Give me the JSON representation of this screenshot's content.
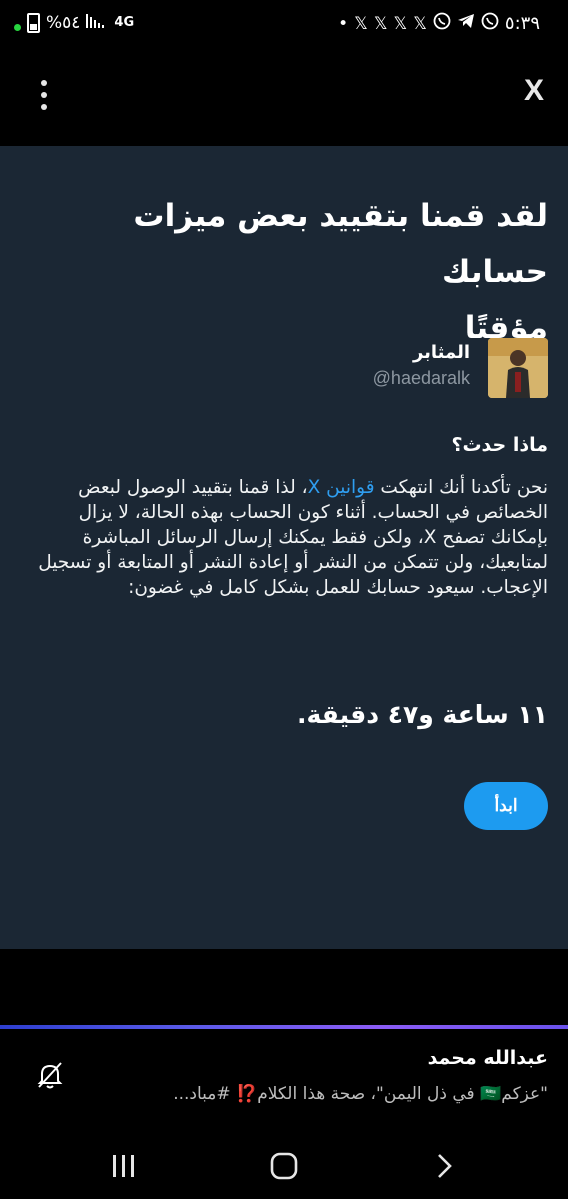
{
  "status_bar": {
    "battery_text": "%٥٤",
    "network_text": "4G",
    "time": "٥:٣٩",
    "notification_icons": [
      "dot-icon",
      "x-icon",
      "x-icon",
      "x-icon",
      "x-icon",
      "whatsapp-icon",
      "telegram-icon",
      "whatsapp-icon"
    ]
  },
  "top_bar": {
    "close_label": "X"
  },
  "panel": {
    "title_line1": "لقد قمنا بتقييد بعض ميزات حسابك",
    "title_line2": "مؤقتًا",
    "user_name": "المثابر",
    "user_handle": "@haedaralk",
    "question": "ماذا حدث؟",
    "body_before_link": "نحن تأكدنا أنك انتهكت ",
    "body_link": "قوانين X",
    "body_after_link": "، لذا قمنا بتقييد الوصول لبعض الخصائص في الحساب. أثناء كون الحساب بهذه الحالة، لا يزال بإمكانك تصفح X، ولكن فقط يمكنك إرسال الرسائل المباشرة لمتابعيك، ولن تتمكن من النشر أو إعادة النشر أو المتابعة أو تسجيل الإعجاب. سيعود حسابك للعمل بشكل كامل في غضون:",
    "timer": "١١ ساعة و٤٧ دقيقة.",
    "start_label": "ابدأ"
  },
  "notification": {
    "title": "عبدالله محمد",
    "text": "\"عزكم🇸🇦 في ذل اليمن\"، صحة هذا الكلام⁉️ #مباد..."
  },
  "colors": {
    "panel_bg": "#1b2734",
    "accent": "#1d9bf0",
    "link": "#2f9ef0"
  }
}
